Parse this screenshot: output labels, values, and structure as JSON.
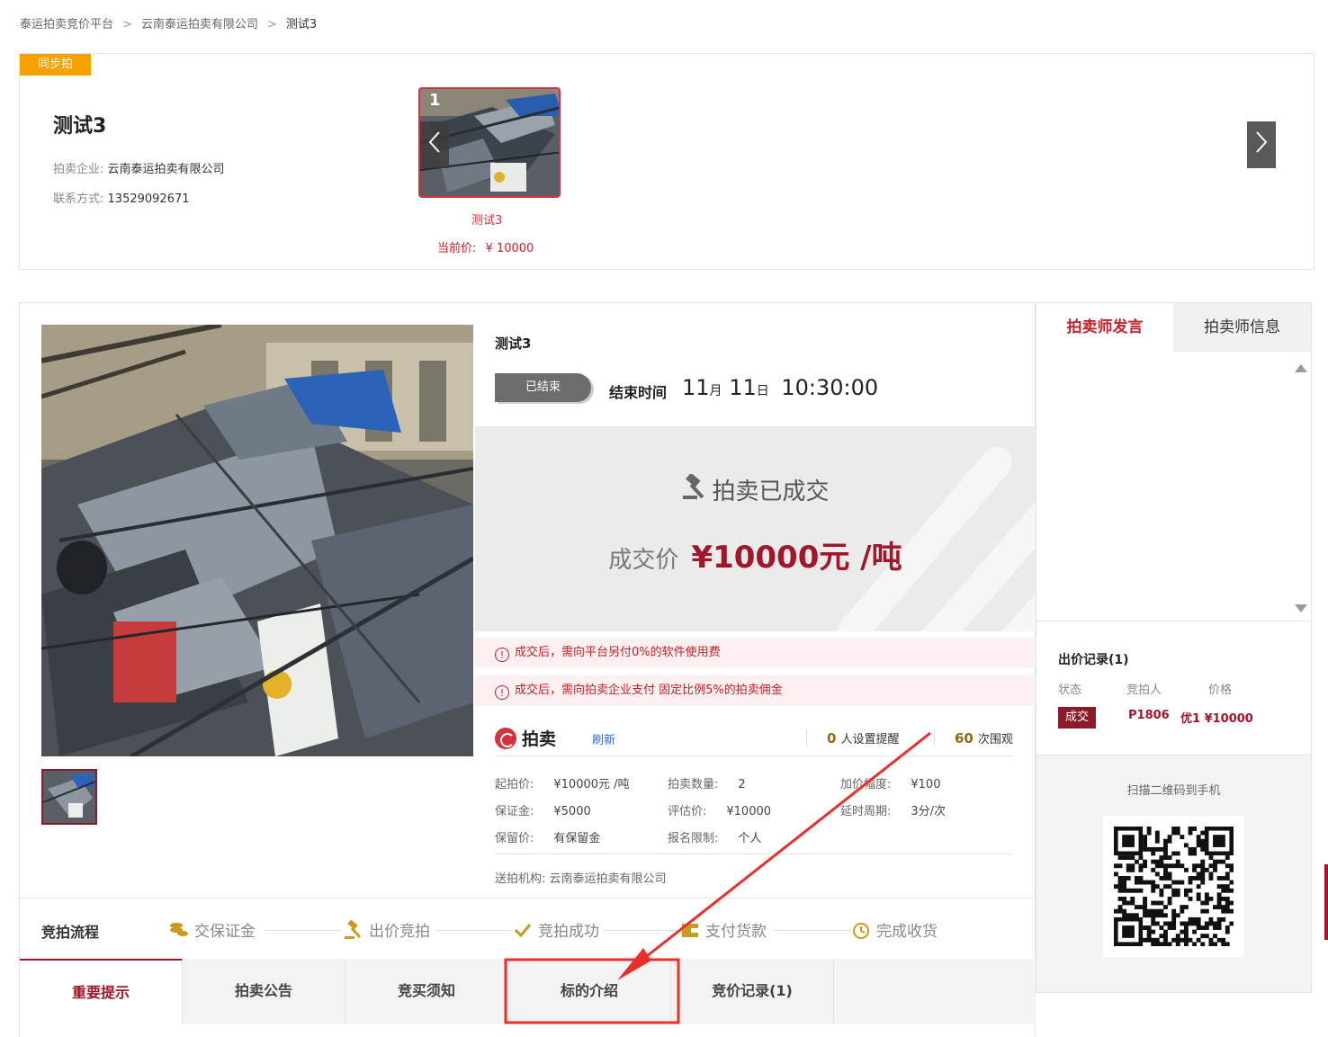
{
  "breadcrumb": {
    "items": [
      "泰运拍卖竞价平台",
      "云南泰运拍卖有限公司",
      "测试3"
    ],
    "separator": ">"
  },
  "lot_header": {
    "tag": "同步拍",
    "title": "测试3",
    "company_label": "拍卖企业:",
    "company": "云南泰运拍卖有限公司",
    "contact_label": "联系方式:",
    "contact": "13529092671",
    "thumb_index": "1",
    "thumb_name": "测试3",
    "thumb_price_label": "当前价:",
    "thumb_price": "¥ 10000"
  },
  "main": {
    "title": "测试3",
    "status": "已结束",
    "end_label": "结束时间",
    "end_month": "11",
    "month_unit": "月",
    "end_day": "11",
    "day_unit": "日",
    "end_clock": "10:30:00",
    "deal_status": "拍卖已成交",
    "deal_price_label": "成交价",
    "deal_price": "¥10000元 /吨",
    "notices": [
      "成交后，需向平台另付0%的软件使用费",
      "成交后，需向拍卖企业支付 固定比例5%的拍卖佣金"
    ],
    "notice_icon": "!",
    "brand": "拍卖",
    "refresh": "刷新",
    "remind_count": "0",
    "remind_text": "人设置提醒",
    "view_count": "60",
    "view_text": "次围观",
    "params": [
      {
        "label": "起拍价:",
        "value": "¥10000元 /吨"
      },
      {
        "label": "拍卖数量:",
        "value": "2"
      },
      {
        "label": "加价幅度:",
        "value": "¥100"
      },
      {
        "label": "保证金:",
        "value": "¥5000"
      },
      {
        "label": "评估价:",
        "value": "¥10000"
      },
      {
        "label": "延时周期:",
        "value": "3分/次"
      },
      {
        "label": "保留价:",
        "value": "有保留金"
      },
      {
        "label": "报名限制:",
        "value": "个人"
      }
    ],
    "org": "送拍机构: 云南泰运拍卖有限公司"
  },
  "flow": {
    "title": "竞拍流程",
    "steps": [
      "交保证金",
      "出价竞拍",
      "竞拍成功",
      "支付货款",
      "完成收货"
    ]
  },
  "tabs": [
    "重要提示",
    "拍卖公告",
    "竞买须知",
    "标的介绍",
    "竞价记录(1)"
  ],
  "right": {
    "tabs": [
      "拍卖师发言",
      "拍卖师信息"
    ],
    "bid_title": "出价记录(1)",
    "bid_headers": [
      "状态",
      "竞拍人",
      "价格"
    ],
    "bid_row": {
      "status": "成交",
      "bidder": "P1806",
      "price": "优1 ¥10000"
    },
    "qr_text": "扫描二维码到手机"
  },
  "colors": {
    "brand_red": "#a3162a",
    "accent_red": "#c0222a",
    "tag_orange": "#f5a200",
    "annotation_red": "#e8302a"
  },
  "icons": [
    "chevron-left-icon",
    "chevron-right-icon",
    "gavel-icon",
    "info-icon",
    "coins-icon",
    "checkmark-icon",
    "wallet-icon",
    "clock-icon",
    "qr-code-icon"
  ]
}
